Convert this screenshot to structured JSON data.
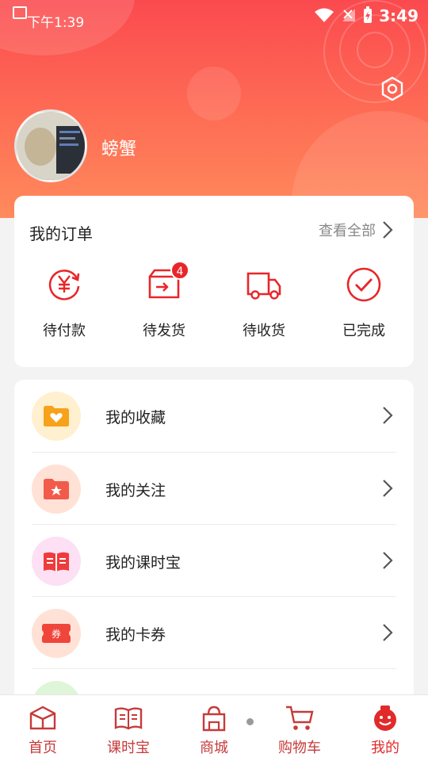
{
  "status_bar": {
    "time_left": "下午1:39",
    "clock_right": "3:49"
  },
  "profile": {
    "username": "螃蟹"
  },
  "orders": {
    "title": "我的订单",
    "view_all": "查看全部",
    "items": [
      {
        "label": "待付款",
        "icon": "yen-refresh-icon",
        "badge": null
      },
      {
        "label": "待发货",
        "icon": "box-ship-icon",
        "badge": "4"
      },
      {
        "label": "待收货",
        "icon": "truck-icon",
        "badge": null
      },
      {
        "label": "已完成",
        "icon": "check-circle-icon",
        "badge": null
      }
    ]
  },
  "menu": {
    "items": [
      {
        "label": "我的收藏",
        "icon": "favorites-folder-icon"
      },
      {
        "label": "我的关注",
        "icon": "star-folder-icon"
      },
      {
        "label": "我的课时宝",
        "icon": "open-book-icon"
      },
      {
        "label": "我的卡券",
        "icon": "coupon-icon",
        "icon_text": "券"
      }
    ]
  },
  "tabbar": {
    "tabs": [
      {
        "label": "首页",
        "icon": "home-box-icon"
      },
      {
        "label": "课时宝",
        "icon": "book-icon"
      },
      {
        "label": "商城",
        "icon": "shop-bag-icon"
      },
      {
        "label": "购物车",
        "icon": "cart-icon"
      },
      {
        "label": "我的",
        "icon": "smiley-profile-icon",
        "active": true
      }
    ]
  },
  "colors": {
    "brand_red": "#e8262a",
    "header_top": "#fb4a4f",
    "header_bottom": "#ff8a5c"
  }
}
